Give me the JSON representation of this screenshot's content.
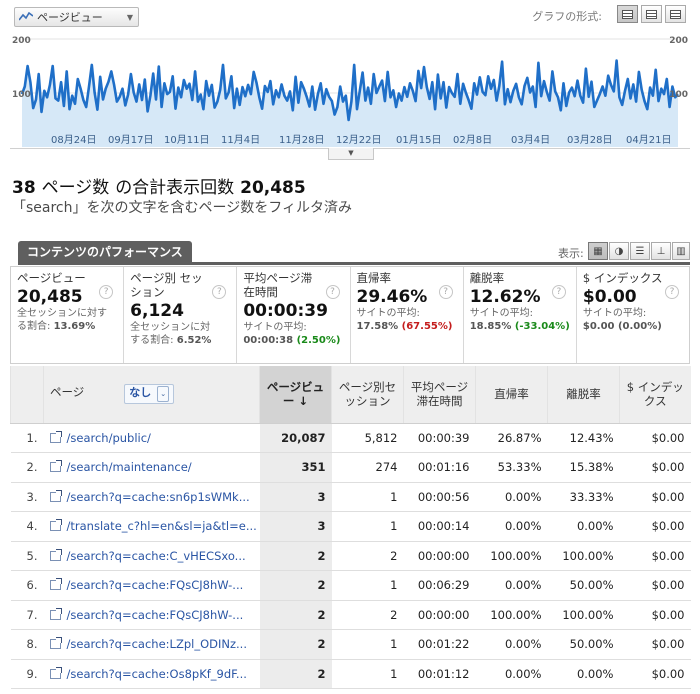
{
  "metric_select": {
    "label": "ページビュー"
  },
  "graph_format": {
    "label": "グラフの形式:"
  },
  "chart_data": {
    "type": "line",
    "ylabel_left": "200",
    "ymid_left": "100",
    "ylabel_right": "200",
    "ymid_right": "100",
    "ylim": [
      0,
      200
    ],
    "x_ticks": [
      "08月24日",
      "09月17日",
      "10月11日",
      "11月4日",
      "11月28日",
      "12月22日",
      "01月15日",
      "02月8日",
      "03月4日",
      "03月28日",
      "04月21日"
    ],
    "series": [
      {
        "values": [
          98,
          112,
          150,
          120,
          72,
          88,
          135,
          65,
          104,
          92,
          115,
          150,
          90,
          86,
          120,
          76,
          140,
          70,
          95,
          80,
          126,
          108,
          87,
          74,
          112,
          152,
          101,
          69,
          130,
          88,
          108,
          121,
          140,
          115,
          84,
          93,
          108,
          77,
          97,
          135,
          101,
          84,
          116,
          87,
          125,
          66,
          95,
          136,
          88,
          149,
          74,
          118,
          98,
          102,
          131,
          71,
          110,
          92,
          124,
          108,
          117,
          87,
          140,
          84,
          97,
          70,
          122,
          95,
          115,
          73,
          84,
          106,
          152,
          90,
          101,
          131,
          72,
          108,
          78,
          111,
          94,
          115,
          98,
          139,
          119,
          92,
          71,
          113,
          102,
          122,
          79,
          105,
          92,
          116,
          95,
          86,
          103,
          68,
          130,
          82,
          120,
          108,
          93,
          75,
          112,
          69,
          98,
          118,
          80,
          107,
          93,
          85,
          60,
          74,
          112,
          84,
          95,
          50,
          84,
          152,
          70,
          104,
          138,
          86,
          110,
          80,
          135,
          100,
          112,
          123,
          85,
          139,
          92,
          105,
          74,
          99,
          86,
          111,
          93,
          118,
          104,
          85,
          141,
          109,
          148,
          111,
          89,
          120,
          70,
          134,
          90,
          120,
          73,
          111,
          100,
          93,
          135,
          80,
          117,
          101,
          87,
          71,
          118,
          97,
          129,
          102,
          96,
          131,
          108,
          124,
          86,
          113,
          158,
          79,
          107,
          83,
          104,
          117,
          92,
          79,
          113,
          128,
          101,
          112,
          74,
          156,
          94,
          122,
          102,
          86,
          140,
          103,
          92,
          68,
          118,
          76,
          101,
          110,
          94,
          123,
          95,
          82,
          145,
          93,
          121,
          74,
          86,
          98,
          112,
          95,
          132,
          115,
          103,
          160,
          92,
          78,
          104,
          126,
          90,
          116,
          84,
          139,
          106,
          85,
          70,
          110,
          95,
          143,
          85,
          108,
          98,
          126,
          74,
          112,
          92,
          98
        ]
      }
    ]
  },
  "headline": {
    "count": "38",
    "text1": "ページ数",
    "text2": "の合計表示回数",
    "total": "20,485"
  },
  "filter_line": "「search」を次の文字を含むページ数をフィルタ済み",
  "section": {
    "tab": "コンテンツのパフォーマンス",
    "view_label": "表示:"
  },
  "cards": [
    {
      "title": "ページビュー",
      "value": "20,485",
      "sub1": "全セッションに対す",
      "sub2": "る割合: ",
      "sub2b": "13.69%",
      "sub2c": ""
    },
    {
      "title": "ページ別 セッション",
      "value": "6,124",
      "sub1": "全セッションに対",
      "sub2": "する割合: ",
      "sub2b": "6.52%",
      "sub2c": ""
    },
    {
      "title": "平均ページ滞在時間",
      "value": "00:00:39",
      "sub1": "サイトの平均:",
      "sub2": "00:00:38 ",
      "sub2b": "",
      "sub2c": "(2.50%)",
      "cls": "pos"
    },
    {
      "title": "直帰率",
      "value": "29.46%",
      "sub1": "サイトの平均:",
      "sub2": "17.58% ",
      "sub2b": "",
      "sub2c": "(67.55%)",
      "cls": "neg"
    },
    {
      "title": "離脱率",
      "value": "12.62%",
      "sub1": "サイトの平均:",
      "sub2": "18.85% ",
      "sub2b": "",
      "sub2c": "(-33.04%)",
      "cls": "pos"
    },
    {
      "title": "$ インデックス",
      "value": "$0.00",
      "sub1": "サイトの平均:",
      "sub2": "$0.00 (0.00%)",
      "sub2b": "",
      "sub2c": ""
    }
  ],
  "table": {
    "headers": {
      "page": "ページ",
      "none": "なし",
      "pv": "ページビュー",
      "sess": "ページ別セッション",
      "avg": "平均ページ滞在時間",
      "bounce": "直帰率",
      "exit": "離脱率",
      "index": "$ インデックス"
    },
    "rows": [
      {
        "n": "1.",
        "page": "/search/public/",
        "pv": "20,087",
        "sess": "5,812",
        "avg": "00:00:39",
        "bounce": "26.87%",
        "exit": "12.43%",
        "idx": "$0.00"
      },
      {
        "n": "2.",
        "page": "/search/maintenance/",
        "pv": "351",
        "sess": "274",
        "avg": "00:01:16",
        "bounce": "53.33%",
        "exit": "15.38%",
        "idx": "$0.00"
      },
      {
        "n": "3.",
        "page": "/search?q=cache:sn6p1sWMk...",
        "pv": "3",
        "sess": "1",
        "avg": "00:00:56",
        "bounce": "0.00%",
        "exit": "33.33%",
        "idx": "$0.00"
      },
      {
        "n": "4.",
        "page": "/translate_c?hl=en&sl=ja&tl=e...",
        "pv": "3",
        "sess": "1",
        "avg": "00:00:14",
        "bounce": "0.00%",
        "exit": "0.00%",
        "idx": "$0.00"
      },
      {
        "n": "5.",
        "page": "/search?q=cache:C_vHECSxo...",
        "pv": "2",
        "sess": "2",
        "avg": "00:00:00",
        "bounce": "100.00%",
        "exit": "100.00%",
        "idx": "$0.00"
      },
      {
        "n": "6.",
        "page": "/search?q=cache:FQsCJ8hW-...",
        "pv": "2",
        "sess": "1",
        "avg": "00:06:29",
        "bounce": "0.00%",
        "exit": "50.00%",
        "idx": "$0.00"
      },
      {
        "n": "7.",
        "page": "/search?q=cache:FQsCJ8hW-...",
        "pv": "2",
        "sess": "2",
        "avg": "00:00:00",
        "bounce": "100.00%",
        "exit": "100.00%",
        "idx": "$0.00"
      },
      {
        "n": "8.",
        "page": "/search?q=cache:LZpl_ODINz...",
        "pv": "2",
        "sess": "1",
        "avg": "00:01:22",
        "bounce": "0.00%",
        "exit": "50.00%",
        "idx": "$0.00"
      },
      {
        "n": "9.",
        "page": "/search?q=cache:Os8pKf_9dF...",
        "pv": "2",
        "sess": "1",
        "avg": "00:01:12",
        "bounce": "0.00%",
        "exit": "0.00%",
        "idx": "$0.00"
      }
    ]
  },
  "colors": {
    "line": "#1f6fc8",
    "fill": "#d6e8f7"
  }
}
